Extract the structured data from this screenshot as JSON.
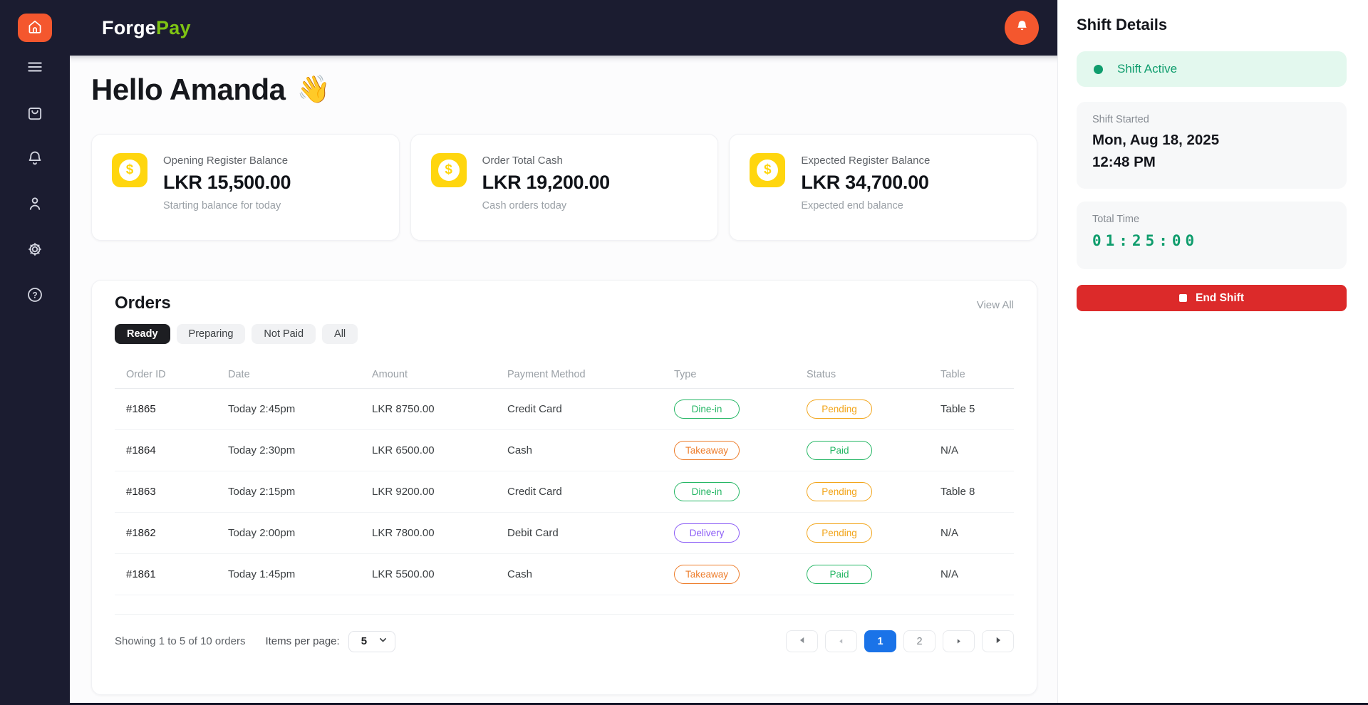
{
  "brand": {
    "name_primary": "Forge",
    "name_secondary": "Pay"
  },
  "sidebar": {
    "items": [
      {
        "icon": "home-icon",
        "active": true
      },
      {
        "icon": "menu-icon"
      },
      {
        "icon": "orders-bag-icon"
      },
      {
        "icon": "notifications-bell-icon"
      },
      {
        "icon": "profile-icon"
      },
      {
        "icon": "settings-gear-icon"
      },
      {
        "icon": "help-icon"
      }
    ]
  },
  "greeting": {
    "title": "Hello Amanda",
    "emoji": "👋"
  },
  "stat_cards": [
    {
      "label": "Opening Register Balance",
      "value": "LKR 15,500.00",
      "sub": "Starting balance for today",
      "icon": "dollar-icon"
    },
    {
      "label": "Order Total Cash",
      "value": "LKR 19,200.00",
      "sub": "Cash orders today",
      "icon": "dollar-icon"
    },
    {
      "label": "Expected Register Balance",
      "value": "LKR 34,700.00",
      "sub": "Expected end balance",
      "icon": "dollar-icon"
    }
  ],
  "orders": {
    "title": "Orders",
    "view_all_label": "View All",
    "tabs": [
      {
        "label": "Ready",
        "active": true
      },
      {
        "label": "Preparing",
        "active": false
      },
      {
        "label": "Not Paid",
        "active": false
      },
      {
        "label": "All",
        "active": false
      }
    ],
    "columns": [
      "Order ID",
      "Date",
      "Amount",
      "Payment Method",
      "Type",
      "Status",
      "Table"
    ],
    "rows": [
      {
        "id": "#1865",
        "date": "Today 2:45pm",
        "amount": "LKR 8750.00",
        "payment": "Credit Card",
        "type": "Dine-in",
        "status": "Pending",
        "table": "Table 5"
      },
      {
        "id": "#1864",
        "date": "Today 2:30pm",
        "amount": "LKR 6500.00",
        "payment": "Cash",
        "type": "Takeaway",
        "status": "Paid",
        "table": "N/A"
      },
      {
        "id": "#1863",
        "date": "Today 2:15pm",
        "amount": "LKR 9200.00",
        "payment": "Credit Card",
        "type": "Dine-in",
        "status": "Pending",
        "table": "Table 8"
      },
      {
        "id": "#1862",
        "date": "Today 2:00pm",
        "amount": "LKR 7800.00",
        "payment": "Debit Card",
        "type": "Delivery",
        "status": "Pending",
        "table": "N/A"
      },
      {
        "id": "#1861",
        "date": "Today 1:45pm",
        "amount": "LKR 5500.00",
        "payment": "Cash",
        "type": "Takeaway",
        "status": "Paid",
        "table": "N/A"
      }
    ],
    "footer": {
      "summary": "Showing 1 to 5 of 10 orders",
      "items_per_page_label": "Items per page:",
      "items_per_page_value": "5"
    },
    "pagination": {
      "pages": [
        "1",
        "2"
      ],
      "active_page": "1"
    }
  },
  "shift_panel": {
    "title": "Shift Details",
    "status_label": "Shift Active",
    "started_label": "Shift Started",
    "started_date": "Mon, Aug 18, 2025",
    "started_time": "12:48 PM",
    "total_time_label": "Total Time",
    "total_time_value": "01:25:00",
    "end_shift_label": "End Shift"
  },
  "colors": {
    "accent_orange": "#f4572e",
    "brand_green": "#7ec313",
    "icon_yellow": "#ffd60e",
    "success_green": "#24b664",
    "pending_amber": "#f2a418",
    "takeaway_orange": "#ed7d2b",
    "delivery_purple": "#8b5cf6",
    "danger_red": "#dc2a2a",
    "active_page_blue": "#1a73e8",
    "timer_green": "#0f9d6d"
  }
}
